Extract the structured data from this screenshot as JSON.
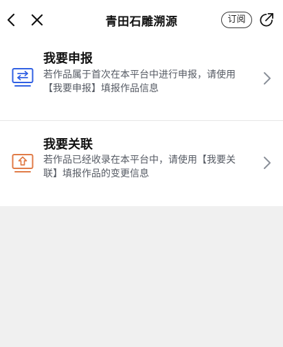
{
  "navbar": {
    "title": "青田石雕溯源",
    "subscribe_label": "订阅",
    "icons": [
      "back-icon",
      "close-icon",
      "share-icon"
    ]
  },
  "menu": [
    {
      "title": "我要申报",
      "description": "若作品属于首次在本平台中进行申报，请使用【我要申报】填报作品信息",
      "icon": "transfer-icon",
      "accent_color": "#2f5fe3"
    },
    {
      "title": "我要关联",
      "description": "若作品已经收录在本平台中，请使用【我要关联】填报作品的变更信息",
      "icon": "upload-icon",
      "accent_color": "#e07a45"
    }
  ],
  "colors": {
    "background": "#f0f0f0",
    "card": "#ffffff",
    "text_primary": "#111111",
    "text_secondary": "#555a63",
    "chevron": "#8a8f99"
  }
}
